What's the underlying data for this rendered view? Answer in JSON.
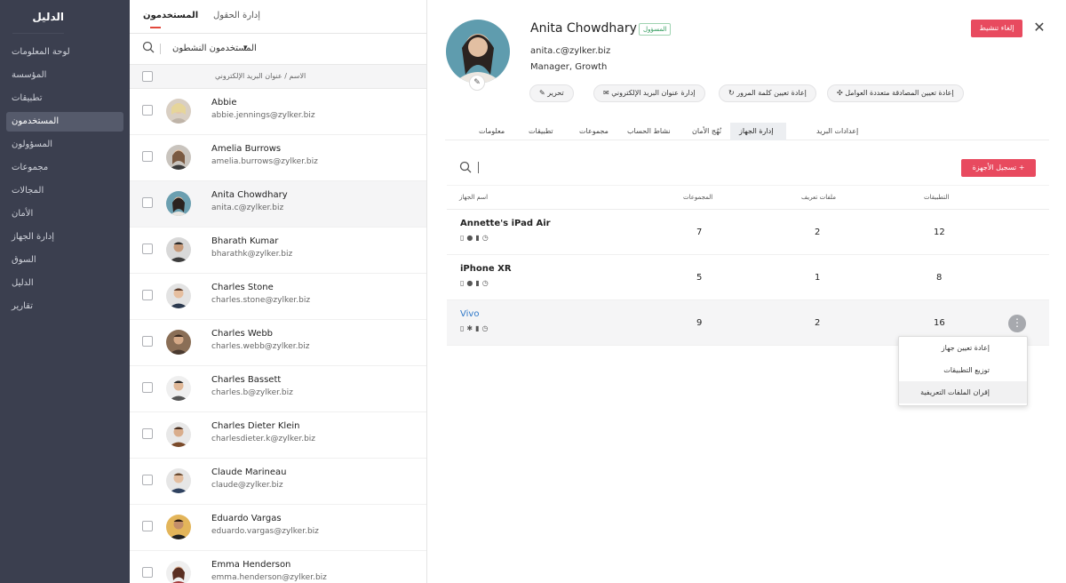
{
  "sidebar": {
    "title": "الدليل",
    "items": [
      {
        "label": "لوحة المعلومات"
      },
      {
        "label": "المؤسسة"
      },
      {
        "label": "تطبيقات"
      },
      {
        "label": "المستخدمون"
      },
      {
        "label": "المسؤولون"
      },
      {
        "label": "مجموعات"
      },
      {
        "label": "المجالات"
      },
      {
        "label": "الأمان"
      },
      {
        "label": "إدارة الجهاز"
      },
      {
        "label": "السوق"
      },
      {
        "label": "الدليل"
      },
      {
        "label": "تقارير"
      }
    ]
  },
  "userlist": {
    "tabs": {
      "users": "المستخدمون",
      "fields": "إدارة الحقول"
    },
    "filter": "المستخدمون النشطون",
    "header": "الاسم / عنوان البريد الإلكتروني",
    "users": [
      {
        "name": "Abbie",
        "email": "abbie.jennings@zylker.biz"
      },
      {
        "name": "Amelia Burrows",
        "email": "amelia.burrows@zylker.biz"
      },
      {
        "name": "Anita Chowdhary",
        "email": "anita.c@zylker.biz"
      },
      {
        "name": "Bharath Kumar",
        "email": "bharathk@zylker.biz"
      },
      {
        "name": "Charles Stone",
        "email": "charles.stone@zylker.biz"
      },
      {
        "name": "Charles Webb",
        "email": "charles.webb@zylker.biz"
      },
      {
        "name": "Charles Bassett",
        "email": "charles.b@zylker.biz"
      },
      {
        "name": "Charles Dieter Klein",
        "email": "charlesdieter.k@zylker.biz"
      },
      {
        "name": "Claude Marineau",
        "email": "claude@zylker.biz"
      },
      {
        "name": "Eduardo Vargas",
        "email": "eduardo.vargas@zylker.biz"
      },
      {
        "name": "Emma Henderson",
        "email": "emma.henderson@zylker.biz"
      }
    ]
  },
  "profile": {
    "name": "Anita Chowdhary",
    "role": "المسؤول",
    "email": "anita.c@zylker.biz",
    "title": "Manager, Growth",
    "deactivate": "إلغاء تنشيط",
    "actions": {
      "edit": "تحرير",
      "manage_email": "إدارة عنوان البريد الإلكتروني",
      "reset_password": "إعادة تعيين كلمة المرور",
      "reset_mfa": "إعادة تعيين المصادقة متعددة العوامل"
    }
  },
  "subtabs": {
    "mail": "إعدادات البريد",
    "device": "إدارة الجهاز",
    "security": "نُهُج الأمان",
    "activity": "نشاط الحساب",
    "groups": "مجموعات",
    "apps": "تطبيقات",
    "info": "معلومات"
  },
  "devices": {
    "register": "تسجيل الأجهزة",
    "columns": {
      "name": "اسم الجهاز",
      "groups": "المجموعات",
      "profiles": "ملفات تعريف",
      "apps": "التطبيقات"
    },
    "rows": [
      {
        "name": "Annette's iPad Air",
        "groups": "7",
        "profiles": "2",
        "apps": "12"
      },
      {
        "name": "iPhone XR",
        "groups": "5",
        "profiles": "1",
        "apps": "8"
      },
      {
        "name": "Vivo",
        "groups": "9",
        "profiles": "2",
        "apps": "16"
      }
    ],
    "menu": {
      "reassign": "إعادة تعيين جهاز",
      "distribute": "توزيع التطبيقات",
      "associate": "إقران الملفات التعريفية"
    }
  },
  "colors": {
    "accent": "#e84a5f",
    "sidebar": "#3b3f4f",
    "link": "#2f79c9"
  }
}
